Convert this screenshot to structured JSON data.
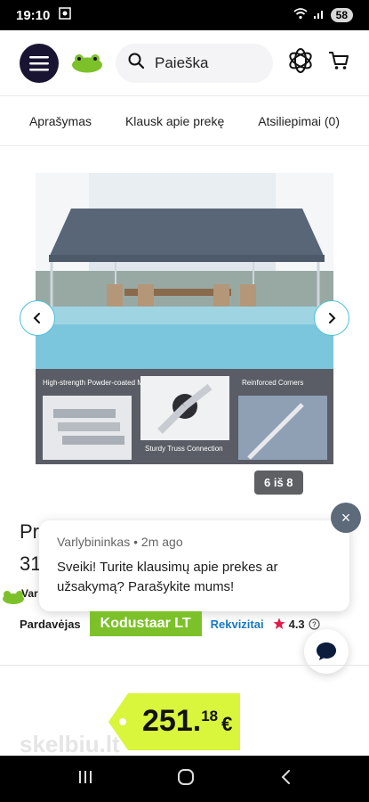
{
  "status": {
    "time": "19:10",
    "battery": "58"
  },
  "header": {
    "search_placeholder": "Paieška"
  },
  "tabs": [
    "Aprašymas",
    "Klausk apie prekę",
    "Atsiliepimai (0)"
  ],
  "gallery": {
    "counter": "6 iš 8",
    "captions": [
      "High-strength Powder-coated Metal Frame",
      "Sturdy Truss Connection",
      "Reinforced Corners"
    ]
  },
  "product": {
    "title_partial": "Pr",
    "sub_partial": "31"
  },
  "chat": {
    "meta": "Varlybininkas • 2m ago",
    "message": "Sveiki! Turite klausimų apie prekes ar užsakymą? Parašykite mums!",
    "close_label": "×"
  },
  "seller": {
    "label": "Pardavėjas",
    "name": "Kodustaar LT",
    "requisites": "Rekvizitai",
    "rating": "4.3",
    "partial_label": "Var"
  },
  "price": {
    "integer": "251.",
    "decimal": "18",
    "currency": "€"
  },
  "watermark": "skelbiu.lt",
  "colors": {
    "accent_green": "#7dc12a",
    "price_tag": "#d9f53c",
    "dark": "#191431",
    "link": "#1779c4"
  }
}
